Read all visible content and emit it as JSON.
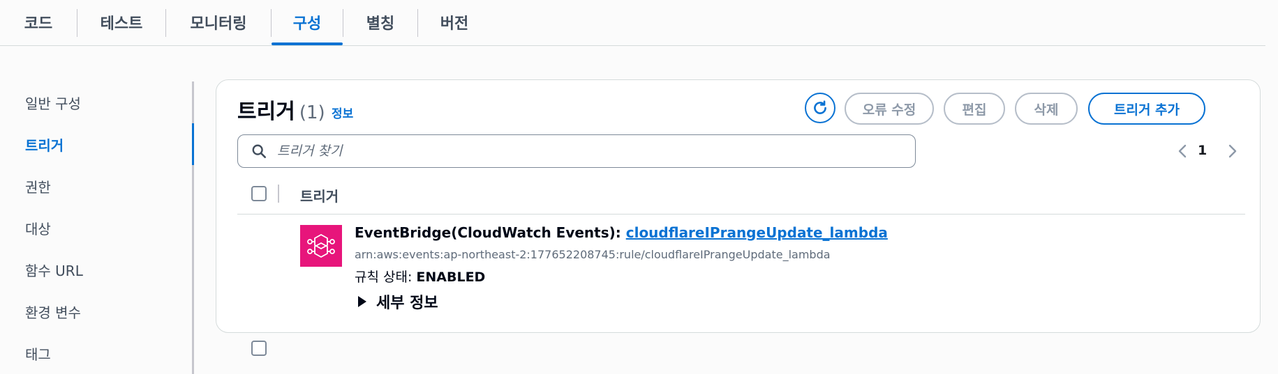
{
  "tabs": [
    {
      "label": "코드"
    },
    {
      "label": "테스트"
    },
    {
      "label": "모니터링"
    },
    {
      "label": "구성",
      "active": true
    },
    {
      "label": "별칭"
    },
    {
      "label": "버전"
    }
  ],
  "sidebar": {
    "items": [
      {
        "label": "일반 구성"
      },
      {
        "label": "트리거",
        "active": true
      },
      {
        "label": "권한"
      },
      {
        "label": "대상"
      },
      {
        "label": "함수 URL"
      },
      {
        "label": "환경 변수"
      },
      {
        "label": "태그"
      }
    ]
  },
  "panel": {
    "title": "트리거",
    "count": "(1)",
    "info_label": "정보",
    "actions": {
      "refresh_icon": "refresh-icon",
      "fix_errors": "오류 수정",
      "edit": "편집",
      "delete": "삭제",
      "add_trigger": "트리거 추가"
    },
    "search": {
      "placeholder": "트리거 찾기",
      "value": ""
    },
    "pagination": {
      "current_page": "1"
    },
    "table": {
      "column_header": "트리거",
      "rows": [
        {
          "source_prefix": "EventBridge(CloudWatch Events): ",
          "rule_name": "cloudflareIPrangeUpdate_lambda",
          "arn": "arn:aws:events:ap-northeast-2:177652208745:rule/cloudflareIPrangeUpdate_lambda",
          "state_label": "규칙 상태: ",
          "state_value": "ENABLED",
          "details_label": "세부 정보",
          "icon": "eventbridge-icon"
        }
      ]
    }
  },
  "colors": {
    "accent": "#0972d3",
    "eventbridge": "#e7157b",
    "text": "#16191f",
    "muted": "#5f6b7a",
    "disabled_border": "#b6bec9"
  }
}
